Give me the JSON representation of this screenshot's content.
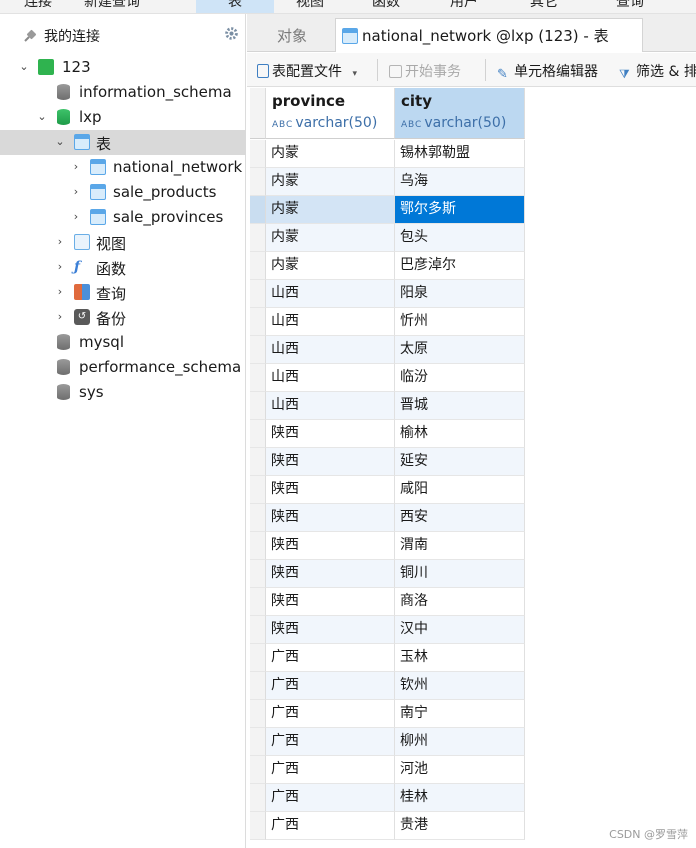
{
  "menubar": {
    "items": [
      "连接",
      "新建查询",
      "表",
      "视图",
      "函数",
      "用户",
      "其它",
      "查询"
    ],
    "active_index": 2
  },
  "navigator": {
    "title": "我的连接",
    "tree": [
      {
        "label": "123",
        "icon": "connection-icon",
        "level": 1,
        "expanded": true
      },
      {
        "label": "information_schema",
        "icon": "database-icon",
        "level": 2
      },
      {
        "label": "lxp",
        "icon": "database-open-icon",
        "level": 2,
        "expanded": true
      },
      {
        "label": "表",
        "icon": "tables-folder-icon",
        "level": 3,
        "expanded": true,
        "selected": true
      },
      {
        "label": "national_network",
        "icon": "table-icon",
        "level": 4
      },
      {
        "label": "sale_products",
        "icon": "table-icon",
        "level": 4
      },
      {
        "label": "sale_provinces",
        "icon": "table-icon",
        "level": 4
      },
      {
        "label": "视图",
        "icon": "view-icon",
        "level": 3
      },
      {
        "label": "函数",
        "icon": "function-icon",
        "level": 3
      },
      {
        "label": "查询",
        "icon": "query-icon",
        "level": 3
      },
      {
        "label": "备份",
        "icon": "backup-icon",
        "level": 3
      },
      {
        "label": "mysql",
        "icon": "database-icon",
        "level": 2
      },
      {
        "label": "performance_schema",
        "icon": "database-icon",
        "level": 2
      },
      {
        "label": "sys",
        "icon": "database-icon",
        "level": 2
      }
    ]
  },
  "tabs": {
    "objects_label": "对象",
    "active_label": "national_network @lxp (123) - 表"
  },
  "toolbar": {
    "table_config": "表配置文件",
    "begin_transaction": "开始事务",
    "cell_editor": "单元格编辑器",
    "filter": "筛选 & 排"
  },
  "grid": {
    "columns": [
      {
        "name": "province",
        "type": "varchar(50)",
        "type_glyph": "A B C"
      },
      {
        "name": "city",
        "type": "varchar(50)",
        "type_glyph": "A B C"
      }
    ],
    "current_row": 2,
    "rows": [
      [
        "内蒙",
        "锡林郭勒盟"
      ],
      [
        "内蒙",
        "乌海"
      ],
      [
        "内蒙",
        "鄂尔多斯"
      ],
      [
        "内蒙",
        "包头"
      ],
      [
        "内蒙",
        "巴彦淖尔"
      ],
      [
        "山西",
        "阳泉"
      ],
      [
        "山西",
        "忻州"
      ],
      [
        "山西",
        "太原"
      ],
      [
        "山西",
        "临汾"
      ],
      [
        "山西",
        "晋城"
      ],
      [
        "陕西",
        "榆林"
      ],
      [
        "陕西",
        "延安"
      ],
      [
        "陕西",
        "咸阳"
      ],
      [
        "陕西",
        "西安"
      ],
      [
        "陕西",
        "渭南"
      ],
      [
        "陕西",
        "铜川"
      ],
      [
        "陕西",
        "商洛"
      ],
      [
        "陕西",
        "汉中"
      ],
      [
        "广西",
        "玉林"
      ],
      [
        "广西",
        "钦州"
      ],
      [
        "广西",
        "南宁"
      ],
      [
        "广西",
        "柳州"
      ],
      [
        "广西",
        "河池"
      ],
      [
        "广西",
        "桂林"
      ],
      [
        "广西",
        "贵港"
      ]
    ]
  },
  "watermark": "CSDN @罗雪萍"
}
